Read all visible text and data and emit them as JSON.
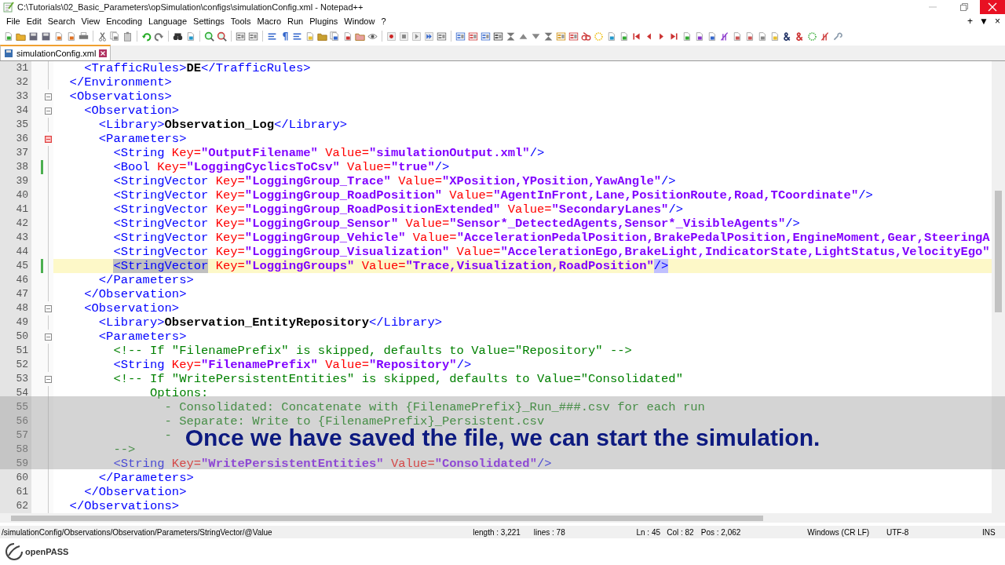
{
  "window": {
    "title": "C:\\Tutorials\\02_Basic_Parameters\\opSimulation\\configs\\simulationConfig.xml - Notepad++"
  },
  "menu": [
    "File",
    "Edit",
    "Search",
    "View",
    "Encoding",
    "Language",
    "Settings",
    "Tools",
    "Macro",
    "Run",
    "Plugins",
    "Window",
    "?"
  ],
  "doc_controls": [
    "+",
    "▼",
    "×"
  ],
  "tabs": [
    {
      "label": "simulationConfig.xml",
      "selected": true
    }
  ],
  "editor": {
    "lines": [
      {
        "number": "31",
        "foldable": false,
        "changed": false,
        "current": false,
        "tokens": [
          {
            "kind": "tag",
            "t": "    <TrafficRules>"
          },
          {
            "kind": "text",
            "t": "DE"
          },
          {
            "kind": "tag",
            "t": "</TrafficRules>"
          }
        ]
      },
      {
        "number": "32",
        "foldable": false,
        "changed": false,
        "current": false,
        "tokens": [
          {
            "kind": "tag",
            "t": "  </Environment>"
          }
        ]
      },
      {
        "number": "33",
        "foldable": true,
        "fold_active": false,
        "changed": false,
        "current": false,
        "tokens": [
          {
            "kind": "tag",
            "t": "  <Observations>"
          }
        ]
      },
      {
        "number": "34",
        "foldable": true,
        "fold_active": false,
        "changed": false,
        "current": false,
        "tokens": [
          {
            "kind": "tag",
            "t": "    <Observation>"
          }
        ]
      },
      {
        "number": "35",
        "foldable": false,
        "changed": false,
        "current": false,
        "tokens": [
          {
            "kind": "tag",
            "t": "      <Library>"
          },
          {
            "kind": "text",
            "t": "Observation_Log"
          },
          {
            "kind": "tag",
            "t": "</Library>"
          }
        ]
      },
      {
        "number": "36",
        "foldable": true,
        "fold_active": true,
        "changed": false,
        "current": false,
        "tokens": [
          {
            "kind": "tag",
            "t": "      <Parameters>"
          }
        ]
      },
      {
        "number": "37",
        "foldable": false,
        "changed": false,
        "current": false,
        "tokens": [
          {
            "kind": "tag",
            "t": "        <String"
          },
          {
            "kind": "attr",
            "t": " Key="
          },
          {
            "kind": "val",
            "t": "\"OutputFilename\""
          },
          {
            "kind": "attr",
            "t": " Value="
          },
          {
            "kind": "val",
            "t": "\"simulationOutput.xml\""
          },
          {
            "kind": "tag",
            "t": "/>"
          }
        ]
      },
      {
        "number": "38",
        "foldable": false,
        "changed": true,
        "current": false,
        "tokens": [
          {
            "kind": "tag",
            "t": "        <Bool"
          },
          {
            "kind": "attr",
            "t": " Key="
          },
          {
            "kind": "val",
            "t": "\"LoggingCyclicsToCsv\""
          },
          {
            "kind": "attr",
            "t": " Value="
          },
          {
            "kind": "val",
            "t": "\"true\""
          },
          {
            "kind": "tag",
            "t": "/>"
          }
        ]
      },
      {
        "number": "39",
        "foldable": false,
        "changed": false,
        "current": false,
        "tokens": [
          {
            "kind": "tag",
            "t": "        <StringVector"
          },
          {
            "kind": "attr",
            "t": " Key="
          },
          {
            "kind": "val",
            "t": "\"LoggingGroup_Trace\""
          },
          {
            "kind": "attr",
            "t": " Value="
          },
          {
            "kind": "val",
            "t": "\"XPosition,YPosition,YawAngle\""
          },
          {
            "kind": "tag",
            "t": "/>"
          }
        ]
      },
      {
        "number": "40",
        "foldable": false,
        "changed": false,
        "current": false,
        "tokens": [
          {
            "kind": "tag",
            "t": "        <StringVector"
          },
          {
            "kind": "attr",
            "t": " Key="
          },
          {
            "kind": "val",
            "t": "\"LoggingGroup_RoadPosition\""
          },
          {
            "kind": "attr",
            "t": " Value="
          },
          {
            "kind": "val",
            "t": "\"AgentInFront,Lane,PositionRoute,Road,TCoordinate\""
          },
          {
            "kind": "tag",
            "t": "/>"
          }
        ]
      },
      {
        "number": "41",
        "foldable": false,
        "changed": false,
        "current": false,
        "tokens": [
          {
            "kind": "tag",
            "t": "        <StringVector"
          },
          {
            "kind": "attr",
            "t": " Key="
          },
          {
            "kind": "val",
            "t": "\"LoggingGroup_RoadPositionExtended\""
          },
          {
            "kind": "attr",
            "t": " Value="
          },
          {
            "kind": "val",
            "t": "\"SecondaryLanes\""
          },
          {
            "kind": "tag",
            "t": "/>"
          }
        ]
      },
      {
        "number": "42",
        "foldable": false,
        "changed": false,
        "current": false,
        "tokens": [
          {
            "kind": "tag",
            "t": "        <StringVector"
          },
          {
            "kind": "attr",
            "t": " Key="
          },
          {
            "kind": "val",
            "t": "\"LoggingGroup_Sensor\""
          },
          {
            "kind": "attr",
            "t": " Value="
          },
          {
            "kind": "val",
            "t": "\"Sensor*_DetectedAgents,Sensor*_VisibleAgents\""
          },
          {
            "kind": "tag",
            "t": "/>"
          }
        ]
      },
      {
        "number": "43",
        "foldable": false,
        "changed": false,
        "current": false,
        "tokens": [
          {
            "kind": "tag",
            "t": "        <StringVector"
          },
          {
            "kind": "attr",
            "t": " Key="
          },
          {
            "kind": "val",
            "t": "\"LoggingGroup_Vehicle\""
          },
          {
            "kind": "attr",
            "t": " Value="
          },
          {
            "kind": "val",
            "t": "\"AccelerationPedalPosition,BrakePedalPosition,EngineMoment,Gear,SteeringA"
          }
        ]
      },
      {
        "number": "44",
        "foldable": false,
        "changed": false,
        "current": false,
        "tokens": [
          {
            "kind": "tag",
            "t": "        <StringVector"
          },
          {
            "kind": "attr",
            "t": " Key="
          },
          {
            "kind": "val",
            "t": "\"LoggingGroup_Visualization\""
          },
          {
            "kind": "attr",
            "t": " Value="
          },
          {
            "kind": "val",
            "t": "\"AccelerationEgo,BrakeLight,IndicatorState,LightStatus,VelocityEgo\""
          }
        ]
      },
      {
        "number": "45",
        "foldable": false,
        "changed": true,
        "current": true,
        "tokens": [
          {
            "kind": "sel",
            "t": "        <StringVector"
          },
          {
            "kind": "attr",
            "t": " Key="
          },
          {
            "kind": "val",
            "t": "\"LoggingGroups\""
          },
          {
            "kind": "attr",
            "t": " Value="
          },
          {
            "kind": "val",
            "t": "\"Trace,Visualization,RoadPosition\""
          },
          {
            "kind": "match",
            "t": "/>"
          }
        ]
      },
      {
        "number": "46",
        "foldable": false,
        "changed": false,
        "current": false,
        "tokens": [
          {
            "kind": "tag",
            "t": "      </Parameters>"
          }
        ]
      },
      {
        "number": "47",
        "foldable": false,
        "changed": false,
        "current": false,
        "tokens": [
          {
            "kind": "tag",
            "t": "    </Observation>"
          }
        ]
      },
      {
        "number": "48",
        "foldable": true,
        "fold_active": false,
        "changed": false,
        "current": false,
        "tokens": [
          {
            "kind": "tag",
            "t": "    <Observation>"
          }
        ]
      },
      {
        "number": "49",
        "foldable": false,
        "changed": false,
        "current": false,
        "tokens": [
          {
            "kind": "tag",
            "t": "      <Library>"
          },
          {
            "kind": "text",
            "t": "Observation_EntityRepository"
          },
          {
            "kind": "tag",
            "t": "</Library>"
          }
        ]
      },
      {
        "number": "50",
        "foldable": true,
        "fold_active": false,
        "changed": false,
        "current": false,
        "tokens": [
          {
            "kind": "tag",
            "t": "      <Parameters>"
          }
        ]
      },
      {
        "number": "51",
        "foldable": false,
        "changed": false,
        "current": false,
        "tokens": [
          {
            "kind": "com",
            "t": "        <!-- If \"FilenamePrefix\" is skipped, defaults to Value=\"Repository\" -->"
          }
        ]
      },
      {
        "number": "52",
        "foldable": false,
        "changed": false,
        "current": false,
        "tokens": [
          {
            "kind": "tag",
            "t": "        <String"
          },
          {
            "kind": "attr",
            "t": " Key="
          },
          {
            "kind": "val",
            "t": "\"FilenamePrefix\""
          },
          {
            "kind": "attr",
            "t": " Value="
          },
          {
            "kind": "val",
            "t": "\"Repository\""
          },
          {
            "kind": "tag",
            "t": "/>"
          }
        ]
      },
      {
        "number": "53",
        "foldable": true,
        "fold_active": false,
        "changed": false,
        "current": false,
        "tokens": [
          {
            "kind": "com",
            "t": "        <!-- If \"WritePersistentEntities\" is skipped, defaults to Value=\"Consolidated\""
          }
        ]
      },
      {
        "number": "54",
        "foldable": false,
        "changed": false,
        "current": false,
        "tokens": [
          {
            "kind": "com",
            "t": "             Options:"
          }
        ]
      },
      {
        "number": "55",
        "foldable": false,
        "changed": false,
        "current": false,
        "tokens": [
          {
            "kind": "com",
            "t": "               - Consolidated: Concatenate with {FilenamePrefix}_Run_###.csv for each run"
          }
        ]
      },
      {
        "number": "56",
        "foldable": false,
        "changed": false,
        "current": false,
        "tokens": [
          {
            "kind": "com",
            "t": "               - Separate: Write to {FilenamePrefix}_Persistent.csv"
          }
        ]
      },
      {
        "number": "57",
        "foldable": false,
        "changed": false,
        "current": false,
        "tokens": [
          {
            "kind": "com",
            "t": "               -"
          }
        ]
      },
      {
        "number": "58",
        "foldable": false,
        "changed": false,
        "current": false,
        "tokens": [
          {
            "kind": "com",
            "t": "        -->"
          }
        ]
      },
      {
        "number": "59",
        "foldable": false,
        "changed": false,
        "current": false,
        "tokens": [
          {
            "kind": "tag",
            "t": "        <String"
          },
          {
            "kind": "attr",
            "t": " Key="
          },
          {
            "kind": "val",
            "t": "\"WritePersistentEntities\""
          },
          {
            "kind": "attr",
            "t": " Value="
          },
          {
            "kind": "val",
            "t": "\"Consolidated\""
          },
          {
            "kind": "tag",
            "t": "/>"
          }
        ]
      },
      {
        "number": "60",
        "foldable": false,
        "changed": false,
        "current": false,
        "tokens": [
          {
            "kind": "tag",
            "t": "      </Parameters>"
          }
        ]
      },
      {
        "number": "61",
        "foldable": false,
        "changed": false,
        "current": false,
        "tokens": [
          {
            "kind": "tag",
            "t": "    </Observation>"
          }
        ]
      },
      {
        "number": "62",
        "foldable": false,
        "changed": false,
        "current": false,
        "tokens": [
          {
            "kind": "tag",
            "t": "  </Observations>"
          }
        ]
      }
    ]
  },
  "subtitle": "Once we have saved the file, we can start the simulation.",
  "status_bar": {
    "path": "/simulationConfig/Observations/Observation/Parameters/StringVector/@Value",
    "length": "length : 3,221",
    "lines": "lines : 78",
    "ln": "Ln : 45",
    "col": "Col : 82",
    "pos": "Pos : 2,062",
    "eol": "Windows (CR LF)",
    "encoding": "UTF-8",
    "mode": "INS"
  },
  "logo": {
    "text": "openPASS"
  }
}
